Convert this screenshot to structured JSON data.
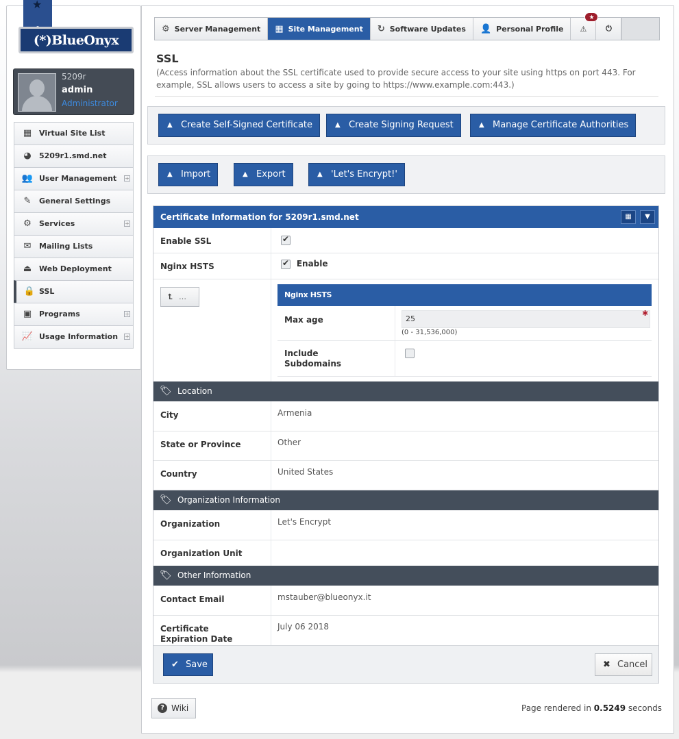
{
  "brand": {
    "logo_text": "(*)BlueOnyx"
  },
  "user": {
    "host": "5209r",
    "name": "admin",
    "role": "Administrator"
  },
  "sidebar": {
    "items": [
      {
        "label": "Virtual Site List",
        "icon": "site-list-icon",
        "expandable": false,
        "active": false
      },
      {
        "label": "5209r1.smd.net",
        "icon": "firefox-globe-icon",
        "expandable": false,
        "active": false
      },
      {
        "label": "User Management",
        "icon": "users-icon",
        "expandable": true,
        "active": false
      },
      {
        "label": "General Settings",
        "icon": "edit-icon",
        "expandable": false,
        "active": false
      },
      {
        "label": "Services",
        "icon": "gear-icon",
        "expandable": true,
        "active": false
      },
      {
        "label": "Mailing Lists",
        "icon": "envelope-icon",
        "expandable": false,
        "active": false
      },
      {
        "label": "Web Deployment",
        "icon": "upload-icon",
        "expandable": false,
        "active": false
      },
      {
        "label": "SSL",
        "icon": "lock-icon",
        "expandable": false,
        "active": true
      },
      {
        "label": "Programs",
        "icon": "chip-icon",
        "expandable": true,
        "active": false
      },
      {
        "label": "Usage Information",
        "icon": "chart-icon",
        "expandable": true,
        "active": false
      }
    ]
  },
  "topnav": {
    "tabs": [
      {
        "label": "Server Management",
        "icon": "gear-icon",
        "active": false
      },
      {
        "label": "Site Management",
        "icon": "site-icon",
        "active": true
      },
      {
        "label": "Software Updates",
        "icon": "refresh-icon",
        "active": false
      },
      {
        "label": "Personal Profile",
        "icon": "user-icon",
        "active": false
      }
    ],
    "alert_badge": "★"
  },
  "page": {
    "title": "SSL",
    "description": "(Access information about the SSL certificate used to provide secure access to your site using https on port 443. For example, SSL allows users to access a site by going to https://www.example.com:443.)"
  },
  "actions": {
    "row1": [
      "Create Self-Signed Certificate",
      "Create Signing Request",
      "Manage Certificate Authorities"
    ],
    "row2": [
      "Import",
      "Export",
      "'Let's Encrypt!'"
    ]
  },
  "panel": {
    "title": "Certificate Information for 5209r1.smd.net",
    "enable_ssl": {
      "label": "Enable SSL",
      "checked": true
    },
    "nginx_hsts": {
      "label": "Nginx HSTS",
      "checked": true,
      "option_label": "Enable"
    },
    "back_button": "…",
    "hsts_panel": {
      "title": "Nginx HSTS",
      "max_age": {
        "label": "Max age",
        "value": "25",
        "range": "(0 - 31,536,000)"
      },
      "include_subdomains": {
        "label": "Include Subdomains",
        "checked": false
      }
    },
    "location": {
      "title": "Location",
      "city": {
        "label": "City",
        "value": "Armenia"
      },
      "state": {
        "label": "State or Province",
        "value": "Other"
      },
      "country": {
        "label": "Country",
        "value": "United States"
      }
    },
    "organization": {
      "title": "Organization Information",
      "org": {
        "label": "Organization",
        "value": "Let's Encrypt"
      },
      "unit": {
        "label": "Organization Unit",
        "value": ""
      }
    },
    "other": {
      "title": "Other Information",
      "email": {
        "label": "Contact Email",
        "value": "mstauber@blueonyx.it"
      },
      "expiry": {
        "label": "Certificate Expiration Date",
        "value": "July 06 2018"
      }
    },
    "save": "Save",
    "cancel": "Cancel"
  },
  "footer": {
    "wiki": "Wiki",
    "rendered_prefix": "Page rendered in",
    "rendered_time": "0.5249",
    "rendered_suffix": "seconds"
  }
}
